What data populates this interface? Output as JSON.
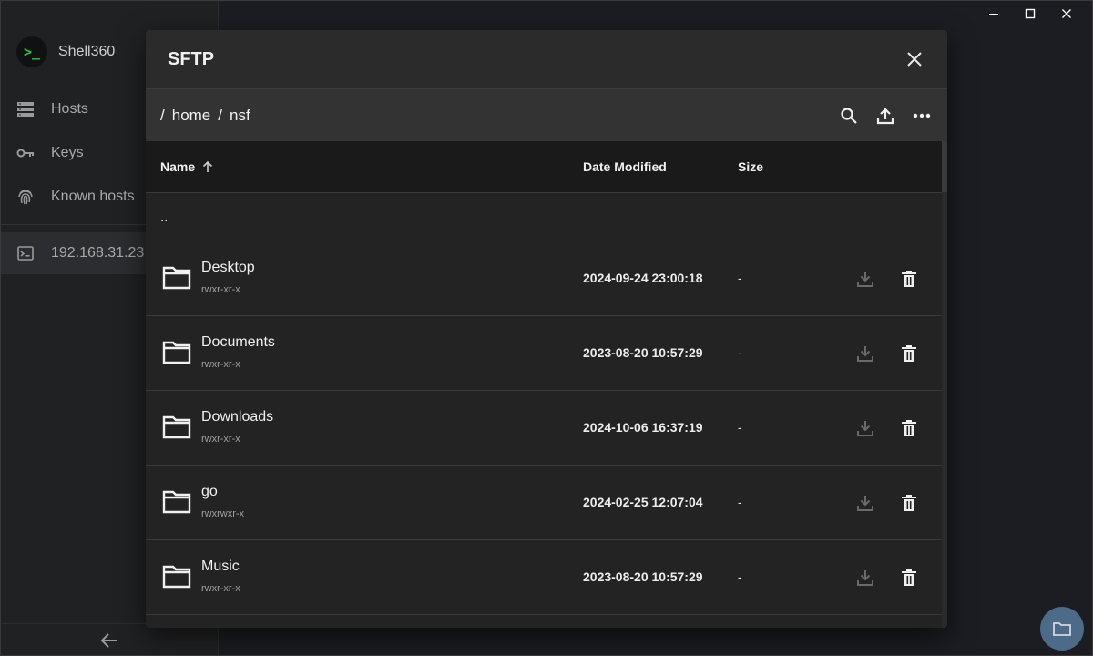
{
  "app": {
    "name": "Shell360"
  },
  "sidebar": {
    "items": [
      {
        "label": "Hosts",
        "icon": "server-icon"
      },
      {
        "label": "Keys",
        "icon": "key-icon"
      },
      {
        "label": "Known hosts",
        "icon": "fingerprint-icon"
      }
    ],
    "session": {
      "label": "192.168.31.23",
      "icon": "terminal-icon"
    }
  },
  "dialog": {
    "title": "SFTP",
    "path": [
      "home",
      "nsf"
    ],
    "path_separator": "/"
  },
  "table": {
    "columns": {
      "name": "Name",
      "date": "Date Modified",
      "size": "Size"
    },
    "sort": {
      "column": "Name",
      "direction": "ascending"
    },
    "parent_entry": "..",
    "rows": [
      {
        "name": "Desktop",
        "perm": "rwxr-xr-x",
        "date": "2024-09-24 23:00:18",
        "size": "-"
      },
      {
        "name": "Documents",
        "perm": "rwxr-xr-x",
        "date": "2023-08-20 10:57:29",
        "size": "-"
      },
      {
        "name": "Downloads",
        "perm": "rwxr-xr-x",
        "date": "2024-10-06 16:37:19",
        "size": "-"
      },
      {
        "name": "go",
        "perm": "rwxrwxr-x",
        "date": "2024-02-25 12:07:04",
        "size": "-"
      },
      {
        "name": "Music",
        "perm": "rwxr-xr-x",
        "date": "2023-08-20 10:57:29",
        "size": "-"
      }
    ]
  },
  "colors": {
    "accent_green": "#2fbf4a",
    "fab": "#4d6a88",
    "dialog_bg": "#232323",
    "pathbar_bg": "#333333"
  }
}
